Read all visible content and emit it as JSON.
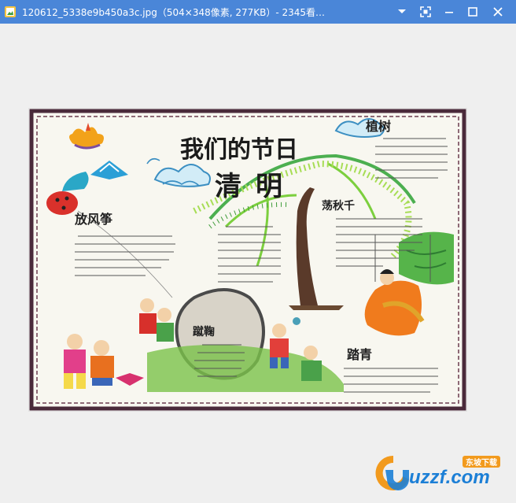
{
  "window": {
    "title": "120612_5338e9b450a3c.jpg（504×348像素, 277KB）- 2345看…"
  },
  "controls": {
    "menu_icon": "chevron-down-icon",
    "fit_icon": "fit-screen-icon",
    "minimize_icon": "minimize-icon",
    "maximize_icon": "maximize-icon",
    "close_icon": "close-icon"
  },
  "poster": {
    "title": "我们的节日",
    "subtitle": "清明",
    "sections": {
      "kite": "放风筝",
      "trees": "植树",
      "swing": "荡秋千",
      "cuju": "蹴鞠",
      "outing": "踏青"
    }
  },
  "watermark": {
    "brand": "uzzf.com",
    "tag": "东坡下载"
  },
  "colors": {
    "titlebar": "#4a86d8",
    "canvas": "#efefef",
    "brand_orange": "#f29a1d",
    "brand_blue": "#1c7fd6"
  }
}
